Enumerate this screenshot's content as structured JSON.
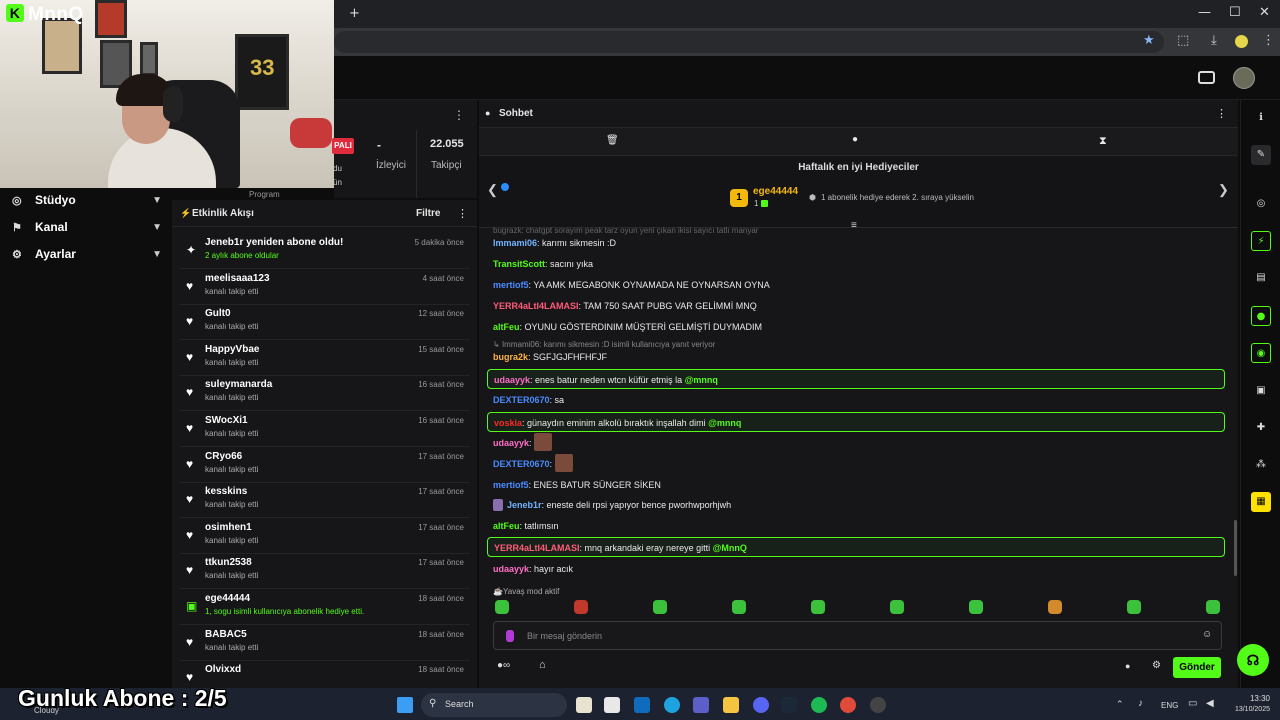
{
  "browser": {
    "new_tab": "+",
    "minimize": "—",
    "maximize": "☐",
    "close": "✕"
  },
  "overlay_logo": "MnnQ",
  "left_nav": {
    "items": [
      {
        "label": "Stüdyo"
      },
      {
        "label": "Kanal"
      },
      {
        "label": "Ayarlar"
      }
    ]
  },
  "stats": {
    "status_badge": "PALI",
    "viewers_value": "-",
    "viewers_label": "İzleyici",
    "followers_value": "22.055",
    "followers_label": "Takipçi",
    "partial_label": "Program",
    "partial_left1": "du",
    "partial_left2": "ün"
  },
  "feed": {
    "title": "Etkinlik Akışı",
    "filter_label": "Filtre",
    "items": [
      {
        "name": "Jeneb1r yeniden abone oldu!",
        "sub": "2 aylık abone oldular",
        "time": "5 dakika önce",
        "icon": "✦",
        "green": true
      },
      {
        "name": "meelisaaa123",
        "sub": "kanalı takip etti",
        "time": "4 saat önce",
        "icon": "♥"
      },
      {
        "name": "Gult0",
        "sub": "kanalı takip etti",
        "time": "12 saat önce",
        "icon": "♥"
      },
      {
        "name": "HappyVbae",
        "sub": "kanalı takip etti",
        "time": "15 saat önce",
        "icon": "♥"
      },
      {
        "name": "suleymanarda",
        "sub": "kanalı takip etti",
        "time": "16 saat önce",
        "icon": "♥"
      },
      {
        "name": "SWocXi1",
        "sub": "kanalı takip etti",
        "time": "16 saat önce",
        "icon": "♥"
      },
      {
        "name": "CRyo66",
        "sub": "kanalı takip etti",
        "time": "17 saat önce",
        "icon": "♥"
      },
      {
        "name": "kesskins",
        "sub": "kanalı takip etti",
        "time": "17 saat önce",
        "icon": "♥"
      },
      {
        "name": "osimhen1",
        "sub": "kanalı takip etti",
        "time": "17 saat önce",
        "icon": "♥"
      },
      {
        "name": "ttkun2538",
        "sub": "kanalı takip etti",
        "time": "17 saat önce",
        "icon": "♥"
      },
      {
        "name": "ege44444",
        "sub": "1, sogu isimli kullanıcıya abonelik hediye etti.",
        "time": "18 saat önce",
        "icon": "▣",
        "green": true
      },
      {
        "name": "BABAC5",
        "sub": "kanalı takip etti",
        "time": "18 saat önce",
        "icon": "♥"
      },
      {
        "name": "Olvixxd",
        "sub": "",
        "time": "18 saat önce",
        "icon": "♥"
      }
    ]
  },
  "chat": {
    "title": "Sohbet",
    "gifters_title": "Haftalık en iyi Hediyeciler",
    "top_gifter_rank": "1",
    "top_gifter_name": "ege44444",
    "top_gifter_count": "1",
    "gifters_hint": "1 abonelik hediye ederek 2. sıraya yükselin",
    "top_reply": "bugrazk: chatgpt sorayım peak tarz oyun yeni çıkan ikisi sayıcı tatlı manyar",
    "messages": [
      {
        "user": "Immami06",
        "color": "#6fb3ff",
        "text": ": karımı sikmesin :D"
      },
      {
        "user": "TransitScott",
        "color": "#53fc18",
        "text": ": sacını yıka"
      },
      {
        "user": "mertiof5",
        "color": "#4a8cff",
        "text": ": YA AMK MEGABONK OYNAMADA NE OYNARSAN OYNA"
      },
      {
        "user": "YERR4aLtI4LAMASI",
        "color": "#ff5c7a",
        "text": ": TAM 750 SAAT PUBG VAR GELİMMİ MNQ"
      },
      {
        "user": "altFeu",
        "color": "#53fc18",
        "text": ": OYUNU GÖSTERDINIM MÜŞTERİ GELMİŞTİ DUYMADIM"
      },
      {
        "user": "bugra2k",
        "color": "#ffb347",
        "text": ": SGFJGJFHFHFJF"
      },
      {
        "user": "udaayyk",
        "color": "#ff6ec7",
        "text": ": enes batur neden wtcn küfür etmiş la ",
        "mention": "@mnnq"
      },
      {
        "user": "DEXTER0670",
        "color": "#4a8cff",
        "text": ": sa"
      },
      {
        "user": "voskia",
        "color": "#ff2a2a",
        "text": ": günaydın eminim alkolü bıraktık inşallah dimi ",
        "mention": "@mnnq"
      },
      {
        "user": "udaayyk",
        "color": "#ff6ec7",
        "text": ":"
      },
      {
        "user": "DEXTER0670",
        "color": "#4a8cff",
        "text": ":"
      },
      {
        "user": "mertiof5",
        "color": "#4a8cff",
        "text": ": ENES BATUR SÜNGER SİKEN"
      },
      {
        "user": "Jeneb1r",
        "color": "#6fb3ff",
        "text": ": eneste deli rpsi yapıyor bence pworhwporhjwh"
      },
      {
        "user": "altFeu",
        "color": "#53fc18",
        "text": ": tatlımsın"
      },
      {
        "user": "YERR4aLtI4LAMASI",
        "color": "#ff5c7a",
        "text": ": mnq arkandaki eray nereye gitti ",
        "mention": "@MnnQ"
      },
      {
        "user": "udaayyk",
        "color": "#ff6ec7",
        "text": ": hayır acık"
      }
    ],
    "reply_note": "Immami06: karımı sikmesin :D isimli kullanıcıya yanıt veriyor",
    "slow_mode": "Yavaş mod aktif",
    "input_placeholder": "Bir mesaj gönderin",
    "send_label": "Gönder"
  },
  "taskbar": {
    "search_label": "Search",
    "weather": "Cloudy",
    "lang": "ENG",
    "time": "13:30",
    "date": "13/10/2025"
  },
  "stream_overlay": "Gunluk Abone : 2/5",
  "colors": {
    "accent": "#53fc18",
    "highlight_border": "#53fc18"
  }
}
